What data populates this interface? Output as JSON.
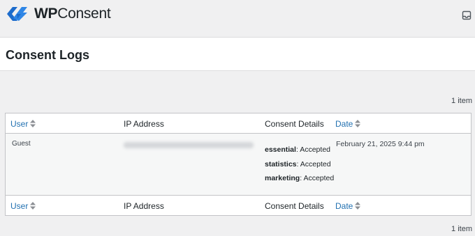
{
  "brand": {
    "name_prefix": "WP",
    "name_suffix": "Consent",
    "logo_icon": "wpconsent-logo-icon",
    "accent_color": "#2271b1"
  },
  "header": {
    "inbox_icon": "inbox-icon"
  },
  "page": {
    "title": "Consent Logs"
  },
  "pagination": {
    "top_count": "1 item",
    "bottom_count": "1 item"
  },
  "table": {
    "columns": {
      "user": "User",
      "ip": "IP Address",
      "consent": "Consent Details",
      "date": "Date"
    },
    "sort_icon": "sort-arrows-icon",
    "rows": [
      {
        "user": "Guest",
        "ip_blurred": true,
        "consents": [
          {
            "category": "essential",
            "status": "Accepted"
          },
          {
            "category": "statistics",
            "status": "Accepted"
          },
          {
            "category": "marketing",
            "status": "Accepted"
          }
        ],
        "date": "February 21, 2025 9:44 pm"
      }
    ]
  }
}
